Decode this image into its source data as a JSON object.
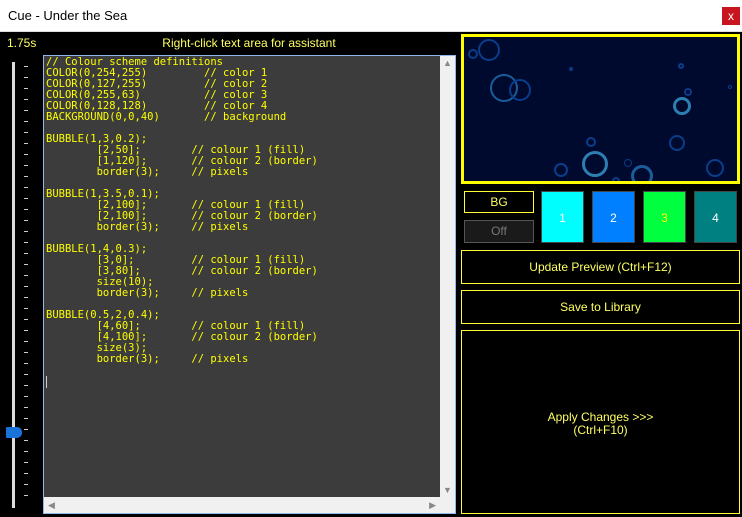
{
  "window": {
    "title": "Cue - Under the Sea",
    "close_label": "x"
  },
  "top": {
    "speed": "1.75s",
    "hint": "Right-click text area for assistant"
  },
  "slider": {
    "value_fraction": 0.83
  },
  "editor": {
    "lines": [
      "// Colour scheme definitions",
      "COLOR(0,254,255)         // color 1",
      "COLOR(0,127,255)         // color 2",
      "COLOR(0,255,63)          // color 3",
      "COLOR(0,128,128)         // color 4",
      "BACKGROUND(0,0,40)       // background",
      "",
      "BUBBLE(1,3,0.2);",
      "        [2,50];        // colour 1 (fill)",
      "        [1,120];       // colour 2 (border)",
      "        border(3);     // pixels",
      "",
      "BUBBLE(1,3.5,0.1);",
      "        [2,100];       // colour 1 (fill)",
      "        [2,100];       // colour 2 (border)",
      "        border(3);     // pixels",
      "",
      "BUBBLE(1,4,0.3);",
      "        [3,0];         // colour 1 (fill)",
      "        [3,80];        // colour 2 (border)",
      "        size(10);",
      "        border(3);     // pixels",
      "",
      "BUBBLE(0.5,2,0.4);",
      "        [4,60];        // colour 1 (fill)",
      "        [4,100];       // colour 2 (border)",
      "        size(3);",
      "        border(3);     // pixels"
    ]
  },
  "controls": {
    "bg_label": "BG",
    "off_label": "Off",
    "swatches": [
      {
        "label": "1",
        "color": "#00feff",
        "text_color": "#ffffff"
      },
      {
        "label": "2",
        "color": "#007fff",
        "text_color": "#ffffff"
      },
      {
        "label": "3",
        "color": "#00ff3f",
        "text_color": "#ffff00"
      },
      {
        "label": "4",
        "color": "#008080",
        "text_color": "#ffffff"
      }
    ],
    "update_label": "Update Preview (Ctrl+F12)",
    "save_label": "Save to Library",
    "apply_line1": "Apply Changes >>>",
    "apply_line2": "(Ctrl+F10)"
  },
  "colors": {
    "accent_yellow": "#ffff00",
    "preview_background": "#000a2e",
    "editor_background": "#3c3c3c"
  }
}
